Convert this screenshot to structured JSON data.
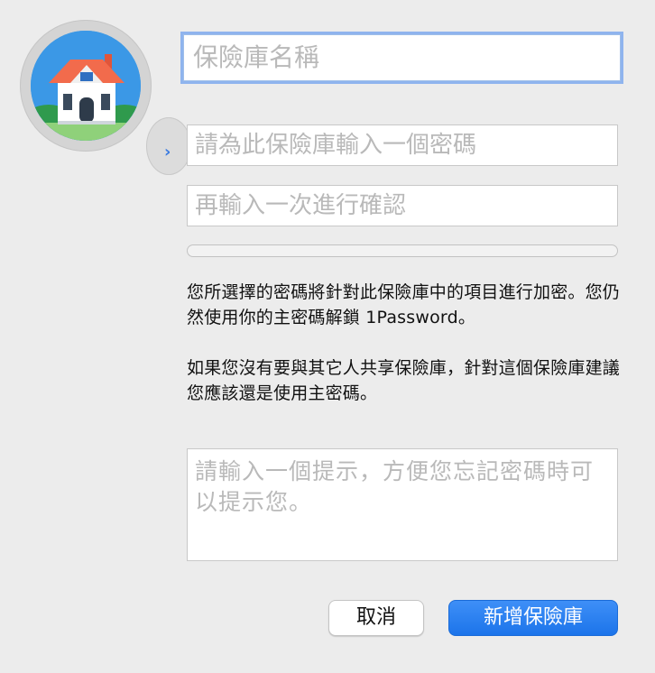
{
  "vault_icon": {
    "icon": "house-icon",
    "chevron": "›"
  },
  "form": {
    "vault_name_placeholder": "保險庫名稱",
    "password_placeholder": "請為此保險庫輸入一個密碼",
    "confirm_placeholder": "再輸入一次進行確認",
    "strength_level": 0,
    "info_paragraph_1": "您所選擇的密碼將針對此保險庫中的項目進行加密。您仍然使用你的主密碼解鎖 1Password。",
    "info_paragraph_2": "如果您沒有要與其它人共享保險庫，針對這個保險庫建議您應該還是使用主密碼。",
    "hint_placeholder": "請輸入一個提示，方便您忘記密碼時可以提示您。"
  },
  "buttons": {
    "cancel": "取消",
    "create": "新增保險庫"
  },
  "colors": {
    "accent": "#1c74ea",
    "focus_ring": "#8fb4ee"
  }
}
